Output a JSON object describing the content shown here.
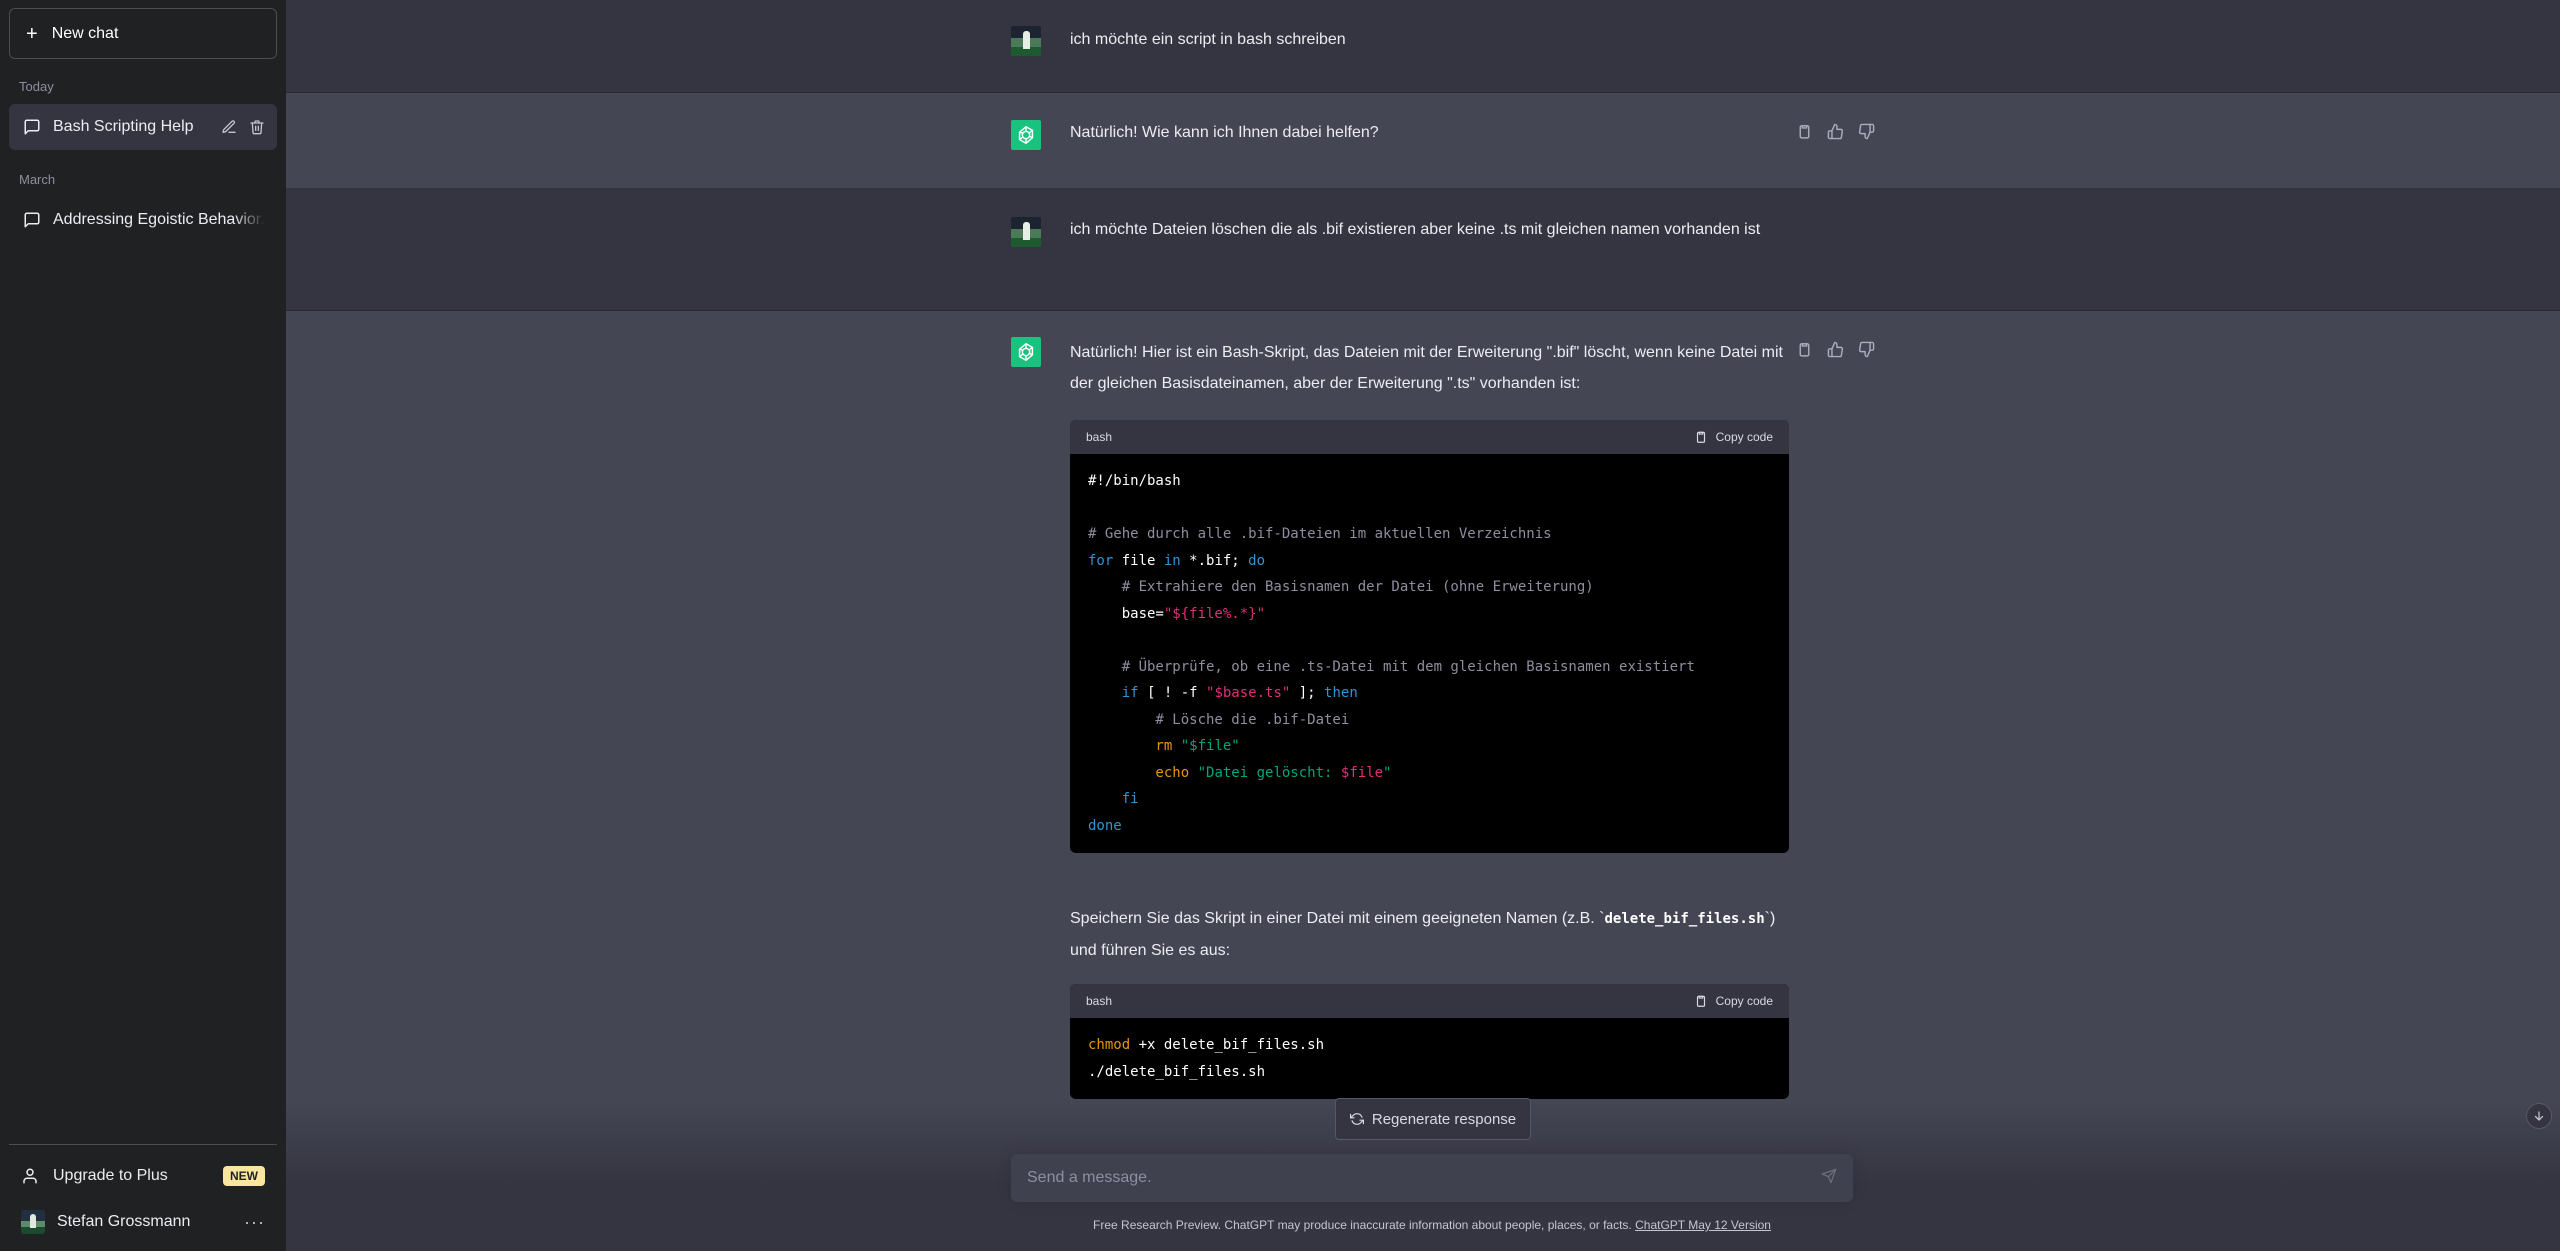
{
  "sidebar": {
    "new_chat_label": "New chat",
    "sections": [
      {
        "label": "Today",
        "items": [
          {
            "label": "Bash Scripting Help",
            "active": true
          }
        ]
      },
      {
        "label": "March",
        "items": [
          {
            "label": "Addressing Egoistic Behavior.",
            "active": false
          }
        ]
      }
    ],
    "upgrade_label": "Upgrade to Plus",
    "upgrade_badge": "NEW",
    "user_name": "Stefan Grossmann",
    "more_label": "···"
  },
  "messages": [
    {
      "role": "user",
      "text": "ich möchte ein script in bash schreiben"
    },
    {
      "role": "assistant",
      "text": "Natürlich! Wie kann ich Ihnen dabei helfen?"
    },
    {
      "role": "user",
      "text": "ich möchte Dateien löschen die als .bif existieren aber keine .ts mit gleichen namen vorhanden ist"
    },
    {
      "role": "assistant",
      "intro": "Natürlich! Hier ist ein Bash-Skript, das Dateien mit der Erweiterung \".bif\" löscht, wenn keine Datei mit der gleichen Basisdateinamen, aber der Erweiterung \".ts\" vorhanden ist:",
      "code1_lang": "bash",
      "code1_copy": "Copy code",
      "after_pre": "Speichern Sie das Skript in einer Datei mit einem geeigneten Namen (z.B. `",
      "after_code": "delete_bif_files.sh",
      "after_post": "`) und führen Sie es aus:",
      "code2_lang": "bash",
      "code2_copy": "Copy code"
    }
  ],
  "code1": {
    "l1": "#!/bin/bash",
    "l3": "# Gehe durch alle .bif-Dateien im aktuellen Verzeichnis",
    "l4_kw1": "for",
    "l4_a": " file ",
    "l4_kw2": "in",
    "l4_b": " *.bif; ",
    "l4_kw3": "do",
    "l5": "    # Extrahiere den Basisnamen der Datei (ohne Erweiterung)",
    "l6_a": "    base=",
    "l6_str": "\"${file%.*}\"",
    "l8": "    # Überprüfe, ob eine .ts-Datei mit dem gleichen Basisnamen existiert",
    "l9_kw": "    if",
    "l9_a": " [ ! -f ",
    "l9_str": "\"$base.ts\"",
    "l9_b": " ]; ",
    "l9_kw2": "then",
    "l10": "        # Lösche die .bif-Datei",
    "l11_cmd": "        rm",
    "l11_a": " ",
    "l11_str": "\"$file\"",
    "l12_cmd": "        echo",
    "l12_a": " ",
    "l12_str": "\"Datei gelöscht: ",
    "l12_var": "$file",
    "l12_end": "\"",
    "l13": "    fi",
    "l14": "done"
  },
  "code2": {
    "l1_cmd": "chmod",
    "l1_a": " +x delete_bif_files.sh",
    "l2": "./delete_bif_files.sh"
  },
  "composer": {
    "placeholder": "Send a message.",
    "regenerate_label": "Regenerate response"
  },
  "footer": {
    "note": "Free Research Preview. ChatGPT may produce inaccurate information about people, places, or facts. ",
    "link": "ChatGPT May 12 Version"
  },
  "colors": {
    "sidebar_bg": "#202123",
    "main_bg": "#343541",
    "bot_bg": "#444654",
    "accent": "#19c37d",
    "badge": "#fae69e"
  }
}
